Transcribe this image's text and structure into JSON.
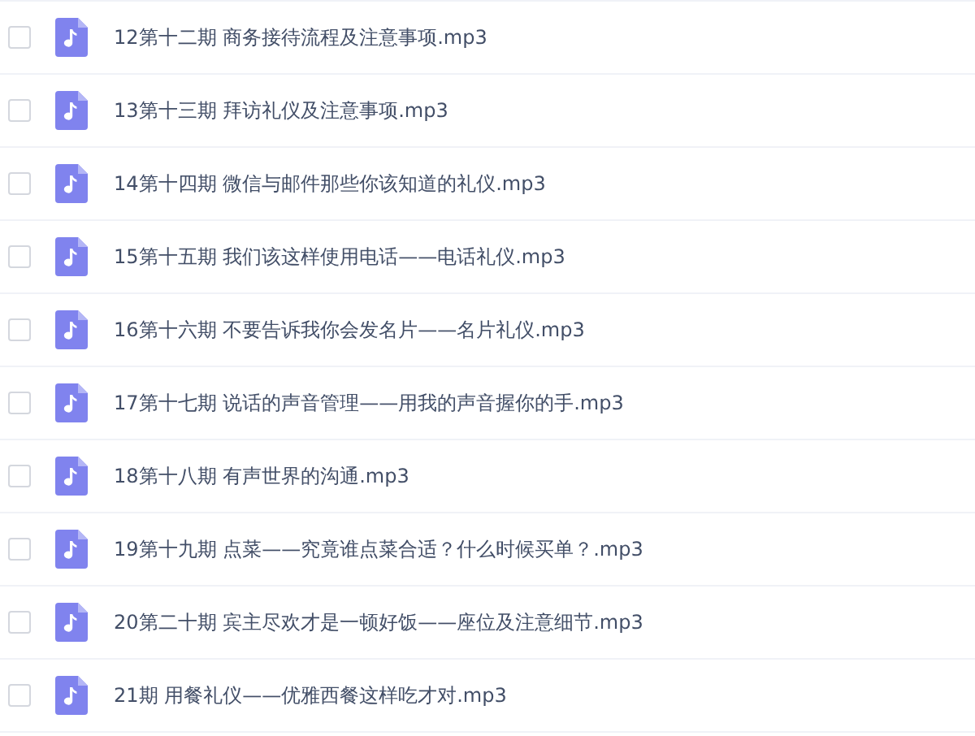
{
  "files": [
    {
      "name": "12第十二期 商务接待流程及注意事项.mp3",
      "checked": false
    },
    {
      "name": "13第十三期 拜访礼仪及注意事项.mp3",
      "checked": false
    },
    {
      "name": "14第十四期 微信与邮件那些你该知道的礼仪.mp3",
      "checked": false
    },
    {
      "name": "15第十五期 我们该这样使用电话——电话礼仪.mp3",
      "checked": false
    },
    {
      "name": "16第十六期 不要告诉我你会发名片——名片礼仪.mp3",
      "checked": false
    },
    {
      "name": "17第十七期 说话的声音管理——用我的声音握你的手.mp3",
      "checked": false
    },
    {
      "name": "18第十八期 有声世界的沟通.mp3",
      "checked": false
    },
    {
      "name": "19第十九期 点菜——究竟谁点菜合适？什么时候买单？.mp3",
      "checked": false
    },
    {
      "name": "20第二十期 宾主尽欢才是一顿好饭——座位及注意细节.mp3",
      "checked": false
    },
    {
      "name": "21期 用餐礼仪——优雅西餐这样吃才对.mp3",
      "checked": false
    }
  ]
}
